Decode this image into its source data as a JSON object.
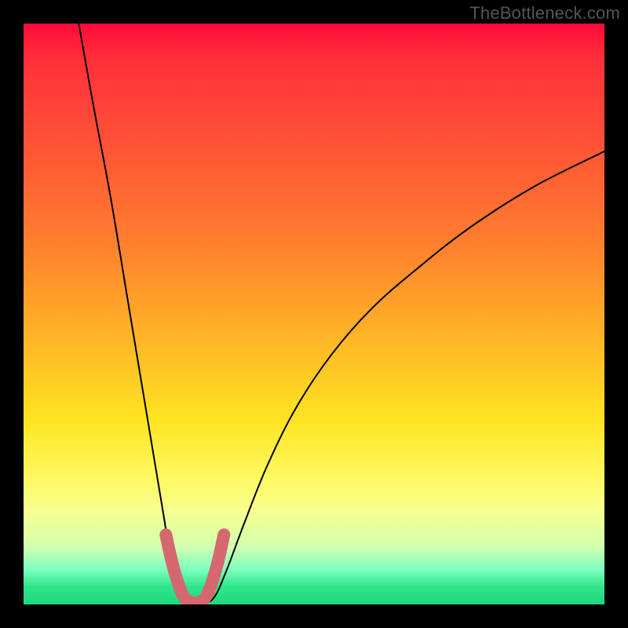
{
  "watermark": "TheBottleneck.com",
  "chart_data": {
    "type": "line",
    "title": "",
    "xlabel": "",
    "ylabel": "",
    "xlim": [
      0,
      1
    ],
    "ylim": [
      0,
      1
    ],
    "series": [
      {
        "name": "main-curve",
        "color": "#000000",
        "stroke_width": 2,
        "x": [
          0.095,
          0.12,
          0.15,
          0.18,
          0.21,
          0.24,
          0.255,
          0.27,
          0.285,
          0.3,
          0.315,
          0.33,
          0.35,
          0.38,
          0.42,
          0.47,
          0.53,
          0.6,
          0.68,
          0.77,
          0.88,
          1.0
        ],
        "y": [
          1.0,
          0.86,
          0.7,
          0.52,
          0.34,
          0.16,
          0.07,
          0.015,
          0.003,
          0.002,
          0.003,
          0.015,
          0.06,
          0.14,
          0.24,
          0.34,
          0.43,
          0.51,
          0.58,
          0.65,
          0.72,
          0.78
        ]
      },
      {
        "name": "highlight-band",
        "color": "#d4676f",
        "stroke_width": 16,
        "x": [
          0.245,
          0.255,
          0.265,
          0.275,
          0.285,
          0.295,
          0.305,
          0.315,
          0.325,
          0.335,
          0.345
        ],
        "y": [
          0.12,
          0.075,
          0.04,
          0.015,
          0.005,
          0.003,
          0.005,
          0.015,
          0.04,
          0.075,
          0.12
        ]
      }
    ]
  }
}
